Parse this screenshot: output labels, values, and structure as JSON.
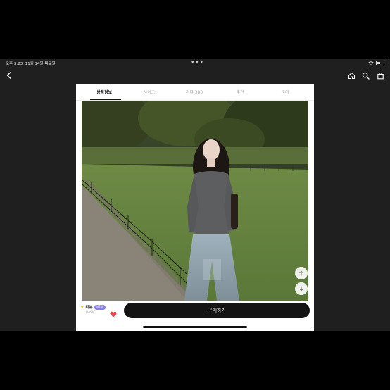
{
  "status": {
    "time": "오후 3:23",
    "date": "11월 14일 목요일"
  },
  "tabs": [
    {
      "label": "상품정보",
      "active": true
    },
    {
      "label": "사이즈",
      "active": false
    },
    {
      "label": "리뷰 380",
      "active": false
    },
    {
      "label": "추천",
      "active": false
    },
    {
      "label": "문의",
      "active": false
    }
  ],
  "brand": {
    "name": "티뷰",
    "badge": "NEW",
    "sub": "BASIC"
  },
  "buy_button": {
    "label": "구매하기"
  },
  "icons": {
    "back": "back-arrow-icon",
    "home": "home-icon",
    "search": "search-icon",
    "cart": "shopping-bag-icon",
    "scroll_up": "arrow-up-icon",
    "scroll_down": "arrow-down-icon",
    "like": "heart-icon"
  },
  "colors": {
    "accent": "#8a7cf0",
    "heart": "#e5484d",
    "button": "#141414"
  }
}
